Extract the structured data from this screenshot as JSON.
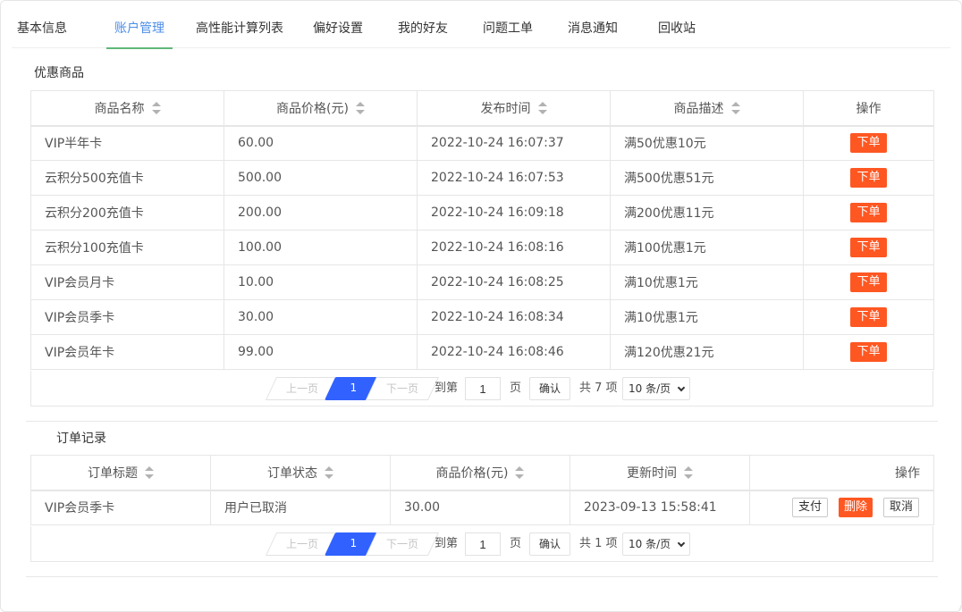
{
  "tabs": [
    {
      "label": "基本信息"
    },
    {
      "label": "账户管理"
    },
    {
      "label": "高性能计算列表"
    },
    {
      "label": "偏好设置"
    },
    {
      "label": "我的好友"
    },
    {
      "label": "问题工单"
    },
    {
      "label": "消息通知"
    },
    {
      "label": "回收站"
    }
  ],
  "active_tab": "账户管理",
  "products": {
    "title": "优惠商品",
    "columns": [
      "商品名称",
      "商品价格(元)",
      "发布时间",
      "商品描述",
      "操作"
    ],
    "rows": [
      {
        "name": "VIP半年卡",
        "price": "60.00",
        "time": "2022-10-24 16:07:37",
        "desc": "满50优惠10元",
        "action": "下单"
      },
      {
        "name": "云积分500充值卡",
        "price": "500.00",
        "time": "2022-10-24 16:07:53",
        "desc": "满500优惠51元",
        "action": "下单"
      },
      {
        "name": "云积分200充值卡",
        "price": "200.00",
        "time": "2022-10-24 16:09:18",
        "desc": "满200优惠11元",
        "action": "下单"
      },
      {
        "name": "云积分100充值卡",
        "price": "100.00",
        "time": "2022-10-24 16:08:16",
        "desc": "满100优惠1元",
        "action": "下单"
      },
      {
        "name": "VIP会员月卡",
        "price": "10.00",
        "time": "2022-10-24 16:08:25",
        "desc": "满10优惠1元",
        "action": "下单"
      },
      {
        "name": "VIP会员季卡",
        "price": "30.00",
        "time": "2022-10-24 16:08:34",
        "desc": "满10优惠1元",
        "action": "下单"
      },
      {
        "name": "VIP会员年卡",
        "price": "99.00",
        "time": "2022-10-24 16:08:46",
        "desc": "满120优惠21元",
        "action": "下单"
      }
    ],
    "pager": {
      "prev": "上一页",
      "current": "1",
      "next": "下一页",
      "goto_label": "到第",
      "goto_value": "1",
      "page_unit": "页",
      "confirm": "确认",
      "total": "共 7 项",
      "page_size": "10 条/页"
    }
  },
  "orders": {
    "title": "订单记录",
    "columns": [
      "订单标题",
      "订单状态",
      "商品价格(元)",
      "更新时间",
      "操作"
    ],
    "rows": [
      {
        "title": "VIP会员季卡",
        "status": "用户已取消",
        "price": "30.00",
        "time": "2023-09-13 15:58:41",
        "pay": "支付",
        "delete": "删除",
        "cancel": "取消"
      }
    ],
    "pager": {
      "prev": "上一页",
      "current": "1",
      "next": "下一页",
      "goto_label": "到第",
      "goto_value": "1",
      "page_unit": "页",
      "confirm": "确认",
      "total": "共 1 项",
      "page_size": "10 条/页"
    }
  },
  "colors": {
    "accent": "#4d8ee8",
    "tab_underline": "#5fb878",
    "danger": "#ff5722",
    "pager_active": "#3162ff"
  }
}
